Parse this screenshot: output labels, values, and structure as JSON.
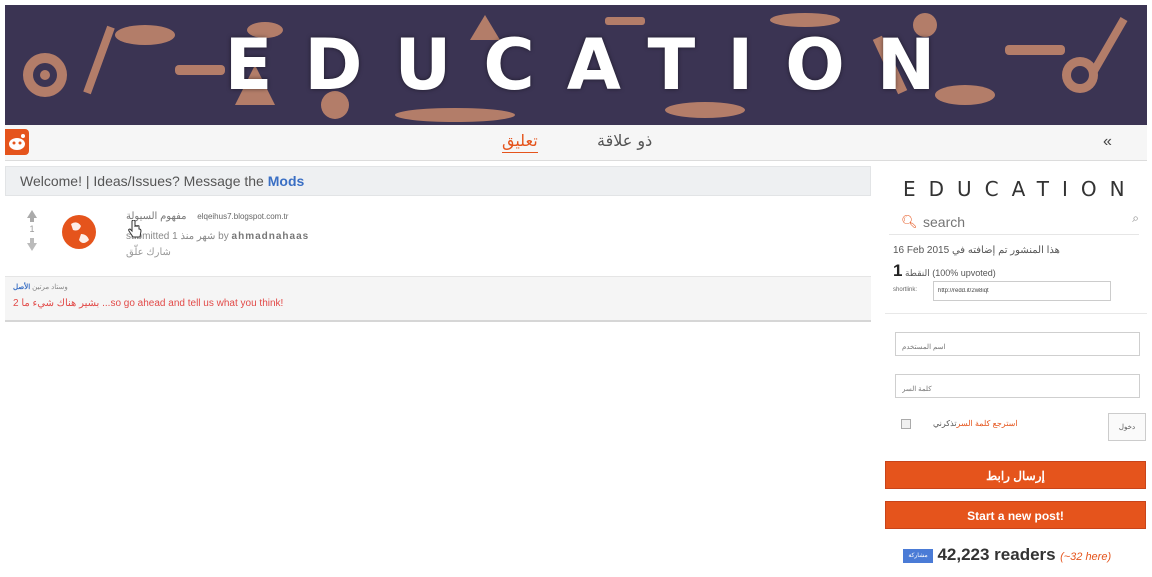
{
  "banner": {
    "title": "EDUCATION"
  },
  "nav": {
    "tab_comments": "تعليق",
    "tab_related": "ذو علاقة",
    "collapse": "«"
  },
  "welcome": {
    "text": "Welcome! | Ideas/Issues? Message the ",
    "link": "Mods"
  },
  "post": {
    "score": "1",
    "title": "مفهوم السيولة",
    "domain": "elqeihus7.blogspot.com.tr",
    "meta_prefix": "submitted 1 شهر منذ by",
    "author": "ahmadnahaas",
    "actions": "شارك   علّق"
  },
  "comment": {
    "meta": "وستاد مرتين",
    "meta_link": "الأصل",
    "text": "2 بشير هناك شيء ما ...so go ahead and tell us what you think!"
  },
  "sidebar": {
    "title": "EDUCATION",
    "search_placeholder": "search",
    "submitted": "16 Feb 2015 هذا المنشور تم إضافته في",
    "points_num": "1",
    "points_text": "النقطة (100% upvoted)",
    "shortlink_label": "shortlink:",
    "shortlink_value": "http://redd.it/2w8iqt",
    "username_placeholder": "اسم المستخدم",
    "password_placeholder": "كلمة السر",
    "remember": "تذكرني",
    "recover": "استرجع كلمة السر",
    "login": "دخول",
    "submit_link": "إرسال رابط",
    "new_post": "Start a new post!",
    "share": "مشاركة",
    "readers": "42,223 readers",
    "here": "(~32 here)"
  },
  "colors": {
    "accent": "#e5541c",
    "link": "#3a6fc4",
    "banner_bg": "#3a3350"
  }
}
